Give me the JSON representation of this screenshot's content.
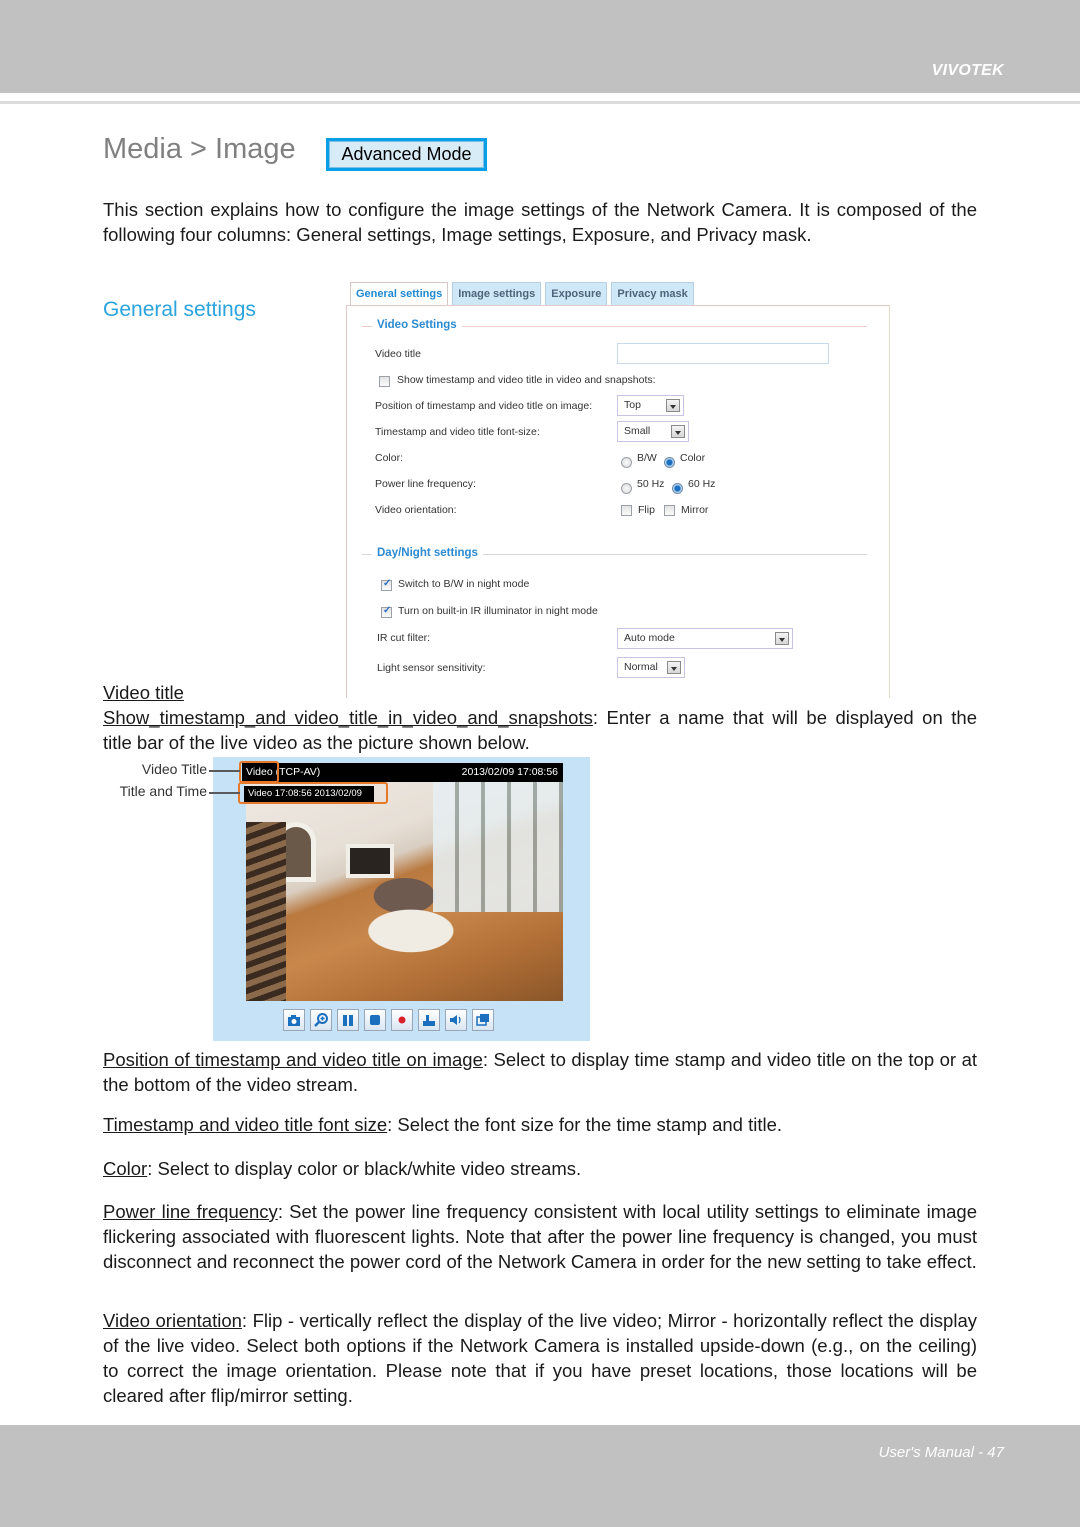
{
  "header": {
    "brand": "VIVOTEK"
  },
  "title": {
    "text": "Media > Image",
    "mode_button": "Advanced Mode"
  },
  "intro": "This section explains how to configure the image settings of the Network Camera. It is composed of the following four columns: General settings, Image settings, Exposure, and Privacy mask.",
  "section_heading": "General settings",
  "settings_panel": {
    "tabs": [
      {
        "label": "General settings",
        "active": true
      },
      {
        "label": "Image settings",
        "active": false
      },
      {
        "label": "Exposure",
        "active": false
      },
      {
        "label": "Privacy mask",
        "active": false
      }
    ],
    "video_settings": {
      "legend": "Video Settings",
      "video_title_label": "Video title",
      "video_title_value": "",
      "show_timestamp_label": "Show timestamp and video title in video and snapshots:",
      "show_timestamp_checked": false,
      "position_label": "Position of timestamp and video title on image:",
      "position_value": "Top",
      "font_size_label": "Timestamp and video title font-size:",
      "font_size_value": "Small",
      "color_label": "Color:",
      "color_options": [
        "B/W",
        "Color"
      ],
      "color_selected": "Color",
      "power_label": "Power line frequency:",
      "power_options": [
        "50 Hz",
        "60 Hz"
      ],
      "power_selected": "60 Hz",
      "orientation_label": "Video orientation:",
      "orientation_options": [
        "Flip",
        "Mirror"
      ],
      "flip_checked": false,
      "mirror_checked": false
    },
    "day_night": {
      "legend": "Day/Night settings",
      "switch_bw_label": "Switch to B/W in night mode",
      "switch_bw_checked": true,
      "ir_illuminator_label": "Turn on built-in IR illuminator in night mode",
      "ir_illuminator_checked": true,
      "ir_cut_label": "IR cut filter:",
      "ir_cut_value": "Auto mode",
      "light_sensor_label": "Light sensor sensitivity:",
      "light_sensor_value": "Normal"
    }
  },
  "video_title_section": {
    "heading": "Video title",
    "term": "Show_timestamp_and video_title_in_video_and_snapshots",
    "desc": ": Enter a name that will be displayed on the title bar of the live video as the picture shown below."
  },
  "preview": {
    "callouts": [
      "Video Title",
      "Title and Time"
    ],
    "titlebar_left": "Video (TCP-AV)",
    "titlebar_right": "2013/02/09  17:08:56",
    "overlay_caption": "Video 17:08:56  2013/02/09",
    "toolbar_icons": [
      "snapshot-icon",
      "zoom-icon",
      "pause-icon",
      "stop-icon",
      "record-icon",
      "volume-slider-icon",
      "speaker-icon",
      "fullscreen-icon"
    ]
  },
  "descriptions": [
    {
      "term": "Position of timestamp and video title on image",
      "text": ": Select to display time stamp and video title on the top or at the bottom of the video stream."
    },
    {
      "term": "Timestamp and video title font size",
      "text": ": Select the font size for the time stamp and title."
    },
    {
      "term": "Color",
      "text": ": Select to display color or black/white video streams."
    },
    {
      "term": "Power line frequency",
      "text": ": Set the power line frequency consistent with local utility settings to eliminate image flickering associated with fluorescent lights. Note that after the power line frequency is changed, you must disconnect and reconnect the power cord of the Network Camera in order for the new setting to take effect."
    },
    {
      "term": "Video orientation",
      "text": ": Flip - vertically reflect the display of the live video; Mirror - horizontally reflect the display of the live video. Select both options if the Network Camera is installed upside-down (e.g., on the ceiling) to correct the image orientation. Please note that if you have preset locations, those locations will be cleared after flip/mirror setting."
    }
  ],
  "footer": {
    "text": "User's Manual - 47"
  }
}
